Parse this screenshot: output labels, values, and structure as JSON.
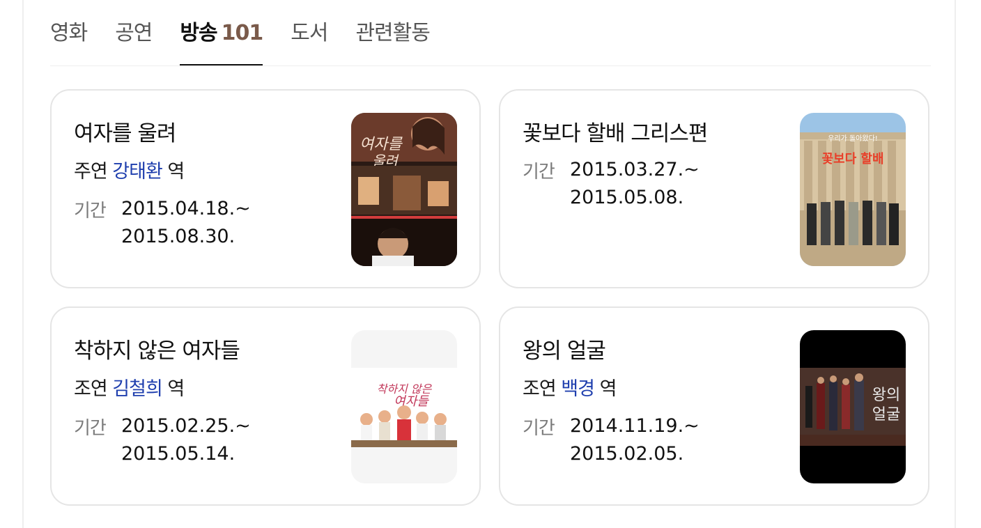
{
  "tabs": [
    {
      "label": "영화",
      "count": "",
      "active": false
    },
    {
      "label": "공연",
      "count": "",
      "active": false
    },
    {
      "label": "방송",
      "count": "101",
      "active": true
    },
    {
      "label": "도서",
      "count": "",
      "active": false
    },
    {
      "label": "관련활동",
      "count": "",
      "active": false
    }
  ],
  "cards": [
    {
      "title": "여자를 울려",
      "role_prefix": "주연",
      "actor": "강태환",
      "role_suffix": "역",
      "period_label": "기간",
      "period_start": "2015.04.18.~",
      "period_end": "2015.08.30."
    },
    {
      "title": "꽃보다 할배 그리스편",
      "role_prefix": "",
      "actor": "",
      "role_suffix": "",
      "period_label": "기간",
      "period_start": "2015.03.27.~",
      "period_end": "2015.05.08."
    },
    {
      "title": "착하지 않은 여자들",
      "role_prefix": "조연",
      "actor": "김철희",
      "role_suffix": "역",
      "period_label": "기간",
      "period_start": "2015.02.25.~",
      "period_end": "2015.05.14."
    },
    {
      "title": "왕의 얼굴",
      "role_prefix": "조연",
      "actor": "백경",
      "role_suffix": "역",
      "period_label": "기간",
      "period_start": "2014.11.19.~",
      "period_end": "2015.02.05."
    }
  ],
  "colors": {
    "actor_link": "#1f3fae",
    "count": "#7a5a4a",
    "card_border": "#e5e5e5"
  }
}
